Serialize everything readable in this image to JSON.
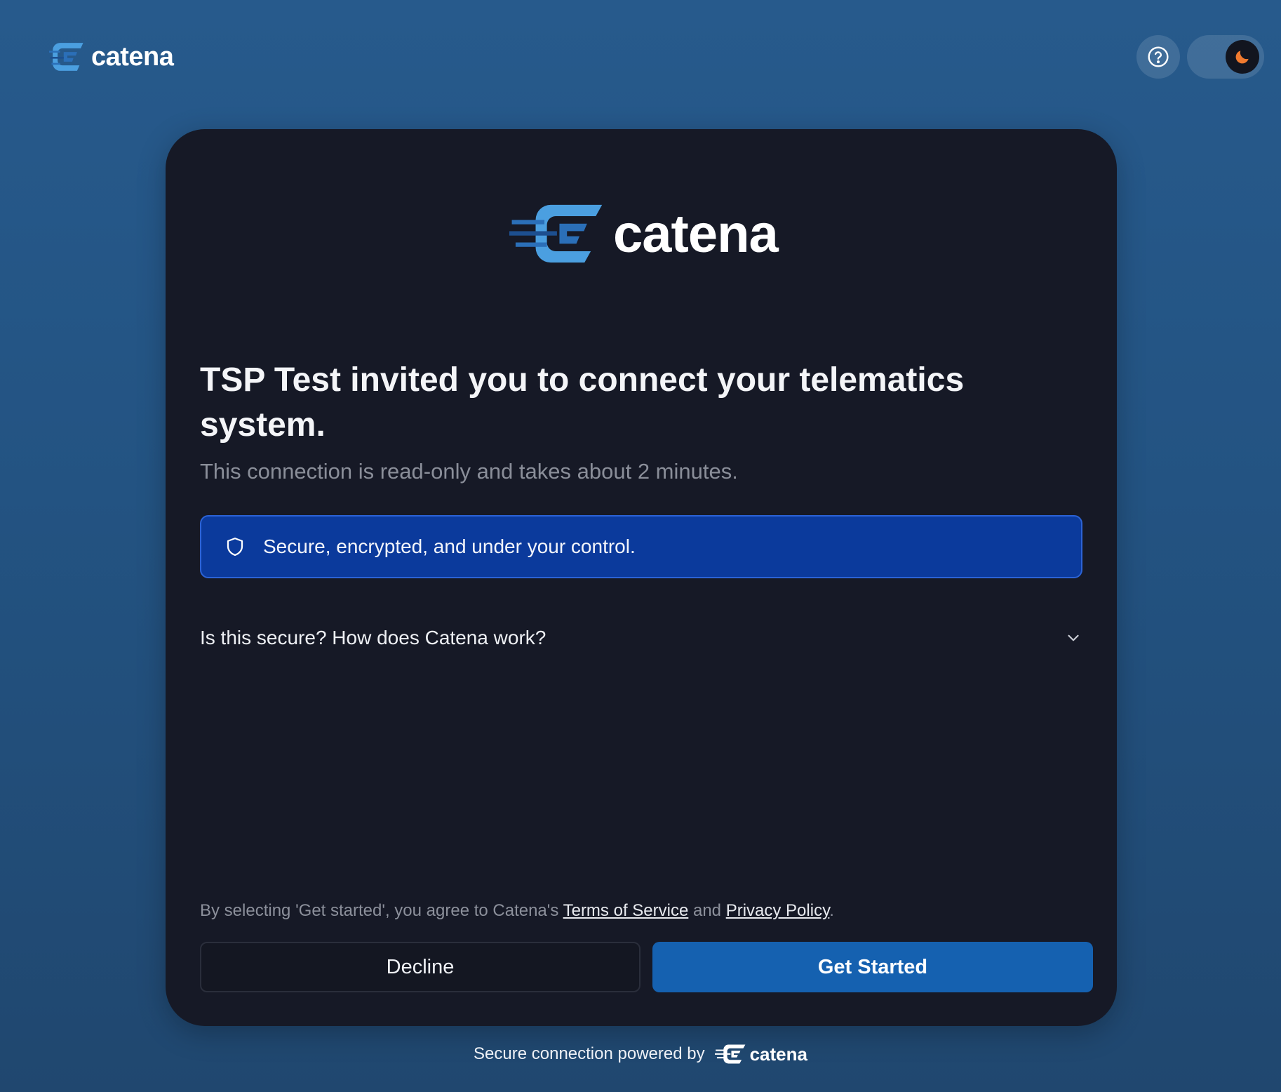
{
  "header": {
    "brand": "catena",
    "help_icon": "help-circle-icon",
    "theme_icon": "moon-icon"
  },
  "card": {
    "brand": "catena",
    "headline": "TSP Test invited you to connect your telematics system.",
    "subtext": "This connection is read-only and takes about 2 minutes.",
    "banner": {
      "icon": "shield-icon",
      "text": "Secure, encrypted, and under your control."
    },
    "faq": {
      "question": "Is this secure? How does Catena work?",
      "icon": "chevron-down-icon"
    },
    "agreement": {
      "prefix": "By selecting 'Get started', you agree to Catena's",
      "terms_link": "Terms of Service",
      "conjunction": "and",
      "privacy_link": "Privacy Policy",
      "suffix": "."
    },
    "decline_label": "Decline",
    "get_started_label": "Get Started"
  },
  "footer": {
    "text": "Secure connection powered by",
    "brand": "catena"
  },
  "colors": {
    "background": "#235382",
    "card": "#161926",
    "banner": "#0b3a9c",
    "primary_button": "#1561b0",
    "moon": "#f07a2f"
  }
}
